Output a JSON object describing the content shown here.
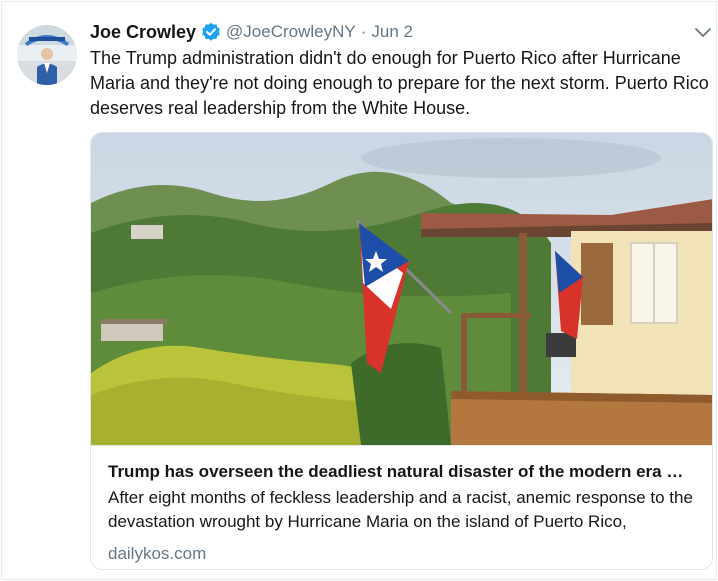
{
  "tweet": {
    "author_name": "Joe Crowley",
    "handle": "@JoeCrowleyNY",
    "separator": "·",
    "time": "Jun 2",
    "text": "The Trump administration didn't do enough for Puerto Rico after Hurricane Maria and they're not doing enough to prepare for the next storm. Puerto Rico deserves real leadership from the White House."
  },
  "card": {
    "title": "Trump has overseen the deadliest natural disaster of the modern era …",
    "description": "After eight months of feckless leadership and a racist, anemic response to the devastation wrought by Hurricane Maria on the island of Puerto Rico,",
    "domain": "dailykos.com"
  },
  "icons": {
    "verified": "verified-badge-icon",
    "caret": "chevron-down-icon"
  },
  "colors": {
    "verified": "#1da1f2",
    "secondary_text": "#657786",
    "border": "#e1e8ed"
  }
}
